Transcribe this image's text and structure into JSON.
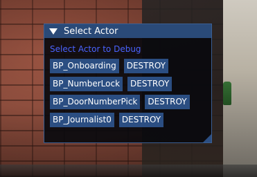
{
  "window": {
    "title": "Select Actor",
    "prompt": "Select Actor to Debug"
  },
  "actors": [
    {
      "name": "BP_Onboarding",
      "destroy_label": "DESTROY"
    },
    {
      "name": "BP_NumberLock",
      "destroy_label": "DESTROY"
    },
    {
      "name": "BP_DoorNumberPick",
      "destroy_label": "DESTROY"
    },
    {
      "name": "BP_Journalist0",
      "destroy_label": "DESTROY"
    }
  ],
  "icons": {
    "collapse": "triangle-down-icon",
    "resize": "resize-grip-icon"
  },
  "colors": {
    "title_bar": "#2A4A78",
    "button": "#2B4E82",
    "prompt_text": "#4A63FF",
    "panel_bg": "#0A0A0E"
  }
}
